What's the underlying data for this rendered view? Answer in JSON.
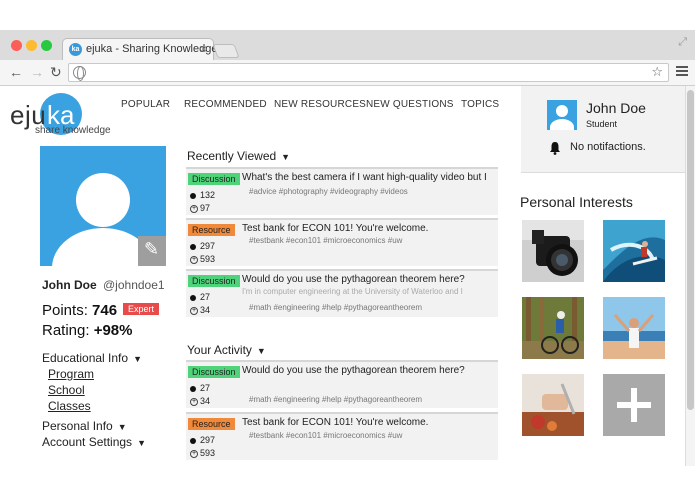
{
  "browser": {
    "tab_title": "ejuka - Sharing Knowledge",
    "tab_icon_text": "ka",
    "close_glyph": "×"
  },
  "site": {
    "logo_left": "eju",
    "logo_right": "ka",
    "tagline": "share knowledge",
    "nav": [
      "POPULAR",
      "RECOMMENDED",
      "NEW RESOURCES",
      "NEW QUESTIONS",
      "TOPICS"
    ]
  },
  "profile": {
    "name": "John Doe",
    "handle": "@johndoe1",
    "points_label": "Points:",
    "points": "746",
    "badge": "Expert",
    "rating_label": "Rating:",
    "rating": "+98%",
    "menu": {
      "educational": "Educational Info",
      "program": "Program",
      "school": "School",
      "classes": "Classes",
      "personal": "Personal Info",
      "account": "Account Settings"
    }
  },
  "recently_viewed": {
    "title": "Recently Viewed",
    "items": [
      {
        "category": "Discussion",
        "title": "What's the best camera if I want high-quality video but I",
        "snippet": "",
        "tags": "#advice  #photography  #videography  #videos",
        "views": "132",
        "votes": "97"
      },
      {
        "category": "Resource",
        "title": "Test bank for ECON 101! You're welcome.",
        "snippet": "",
        "tags": "#testbank  #econ101  #microeconomics  #uw",
        "views": "297",
        "votes": "593"
      },
      {
        "category": "Discussion",
        "title": "Would do you use the pythagorean theorem here?",
        "snippet": "I'm in computer engineering at the University of Waterloo and I",
        "tags": "#math  #engineering  #help  #pythagoreantheorem",
        "views": "27",
        "votes": "34"
      }
    ]
  },
  "activity": {
    "title": "Your Activity",
    "items": [
      {
        "category": "Discussion",
        "title": "Would do you use the pythagorean theorem here?",
        "snippet": "",
        "tags": "#math  #engineering  #help  #pythagoreantheorem",
        "views": "27",
        "votes": "34"
      },
      {
        "category": "Resource",
        "title": "Test bank for ECON 101! You're welcome.",
        "snippet": "",
        "tags": "#testbank  #econ101  #microeconomics  #uw",
        "views": "297",
        "votes": "593"
      }
    ]
  },
  "user_panel": {
    "name": "John Doe",
    "role": "Student",
    "notifications": "No notifactions."
  },
  "interests": {
    "title": "Personal Interests",
    "tiles": [
      "camera",
      "surfing",
      "mountain-biking",
      "travel",
      "cooking",
      "add"
    ]
  },
  "colors": {
    "brand_blue": "#3aa2e0",
    "discussion": "#4fd37a",
    "resource": "#f08a3a",
    "expert": "#e84b4b"
  }
}
